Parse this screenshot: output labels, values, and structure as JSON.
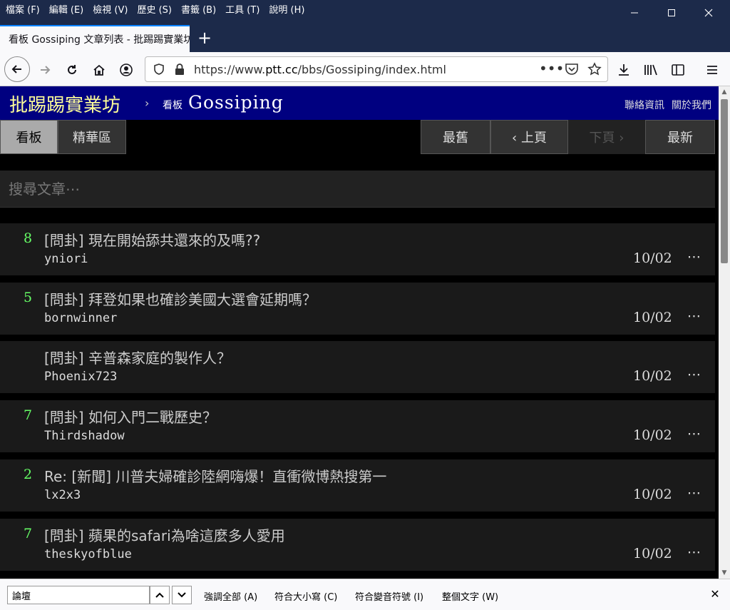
{
  "menubar": [
    "檔案 (F)",
    "編輯 (E)",
    "檢視 (V)",
    "歷史 (S)",
    "書籤 (B)",
    "工具 (T)",
    "說明 (H)"
  ],
  "window_controls": {
    "minimize": "—",
    "maximize": "☐",
    "close": "✕"
  },
  "tab": {
    "title": "看板 Gossiping 文章列表 - 批踢踢實業坊",
    "new_tab_symbol": "+"
  },
  "url": {
    "prefix": "https://www.",
    "domain": "ptt.cc",
    "path": "/bbs/Gossiping/index.html"
  },
  "ptt": {
    "site_name": "批踢踢實業坊",
    "separator": "›",
    "board_label": "看板",
    "board_name": "Gossiping",
    "links": [
      "聯絡資訊",
      "關於我們"
    ],
    "buttons": {
      "board": "看板",
      "digest": "精華區",
      "oldest": "最舊",
      "prev": "‹ 上頁",
      "next": "下頁 ›",
      "newest": "最新"
    },
    "search_placeholder": "搜尋文章⋯",
    "posts": [
      {
        "nrec": "8",
        "title": "[問卦] 現在開始舔共還來的及嗎??",
        "author": "yniori",
        "date": "10/02"
      },
      {
        "nrec": "5",
        "title": "[問卦] 拜登如果也確診美國大選會延期嗎？",
        "author": "bornwinner",
        "date": "10/02"
      },
      {
        "nrec": "",
        "title": "[問卦] 辛普森家庭的製作人？",
        "author": "Phoenix723",
        "date": "10/02"
      },
      {
        "nrec": "7",
        "title": "[問卦] 如何入門二戰歷史？",
        "author": "Thirdshadow",
        "date": "10/02"
      },
      {
        "nrec": "2",
        "title": "Re: [新聞] 川普夫婦確診陸網嗨爆！直衝微博熱搜第一",
        "author": "lx2x3",
        "date": "10/02"
      },
      {
        "nrec": "7",
        "title": "[問卦] 蘋果的safari為啥這麼多人愛用",
        "author": "theskyofblue",
        "date": "10/02"
      }
    ],
    "more_symbol": "⋯"
  },
  "findbar": {
    "query": "論壇",
    "options": [
      "強調全部 (A)",
      "符合大小寫 (C)",
      "符合變音符號 (I)",
      "整個文字 (W)"
    ],
    "close_symbol": "✕"
  },
  "colors": {
    "header_bg": "#000080",
    "site_name": "#ffff99",
    "nrec": "#66ff66",
    "tab_accent": "#0a84ff"
  }
}
